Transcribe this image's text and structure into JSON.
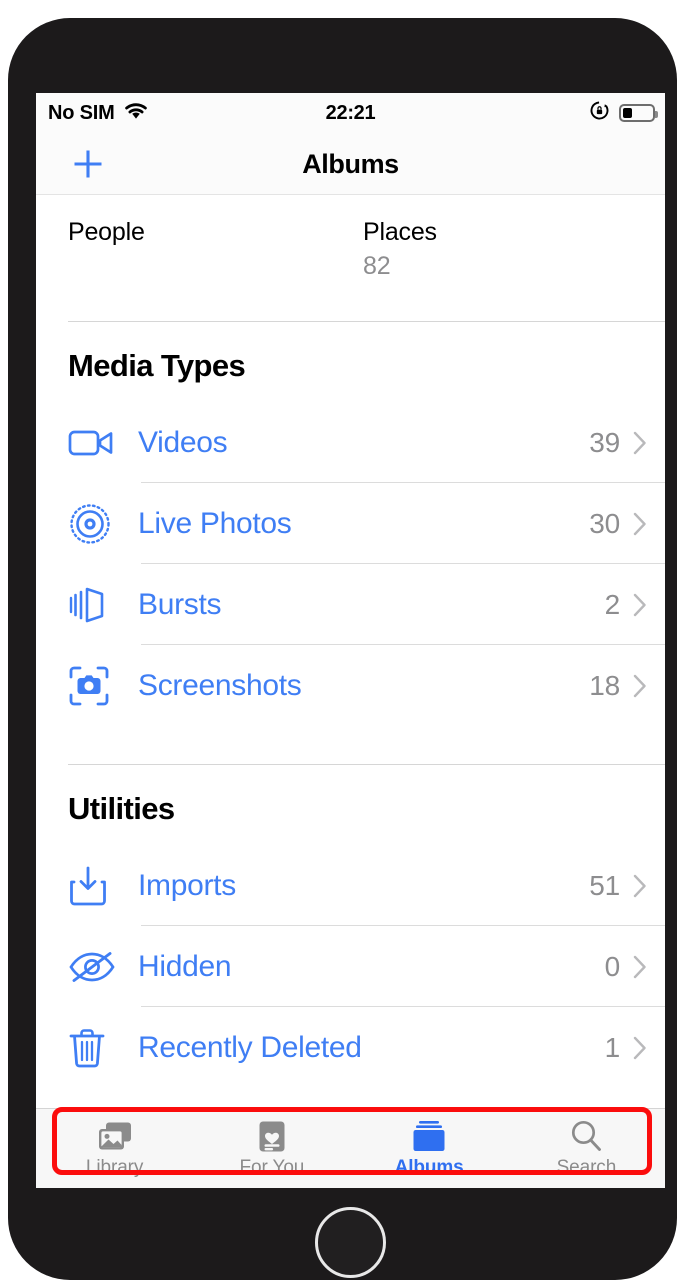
{
  "status_bar": {
    "carrier": "No SIM",
    "wifi_icon": "wifi-icon",
    "time": "22:21",
    "rotation_lock_icon": "rotation-lock-icon",
    "battery_icon": "battery-icon",
    "battery_level_percent": 32
  },
  "nav": {
    "add_icon": "plus-icon",
    "title": "Albums"
  },
  "people_places": {
    "people": {
      "label": "People",
      "count": ""
    },
    "places": {
      "label": "Places",
      "count": "82"
    }
  },
  "sections": [
    {
      "header": "Media Types",
      "rows": [
        {
          "icon": "video-camera-icon",
          "label": "Videos",
          "count": "39",
          "chevron": "chevron-right-icon"
        },
        {
          "icon": "live-photos-icon",
          "label": "Live Photos",
          "count": "30",
          "chevron": "chevron-right-icon"
        },
        {
          "icon": "bursts-icon",
          "label": "Bursts",
          "count": "2",
          "chevron": "chevron-right-icon"
        },
        {
          "icon": "screenshot-camera-icon",
          "label": "Screenshots",
          "count": "18",
          "chevron": "chevron-right-icon"
        }
      ]
    },
    {
      "header": "Utilities",
      "rows": [
        {
          "icon": "import-tray-icon",
          "label": "Imports",
          "count": "51",
          "chevron": "chevron-right-icon"
        },
        {
          "icon": "eye-slash-icon",
          "label": "Hidden",
          "count": "0",
          "chevron": "chevron-right-icon"
        },
        {
          "icon": "trash-icon",
          "label": "Recently Deleted",
          "count": "1",
          "chevron": "chevron-right-icon"
        }
      ]
    }
  ],
  "tabs": [
    {
      "icon": "photo-stack-icon",
      "label": "Library",
      "active": false
    },
    {
      "icon": "heart-card-icon",
      "label": "For You",
      "active": false
    },
    {
      "icon": "albums-folder-icon",
      "label": "Albums",
      "active": true
    },
    {
      "icon": "magnifier-icon",
      "label": "Search",
      "active": false
    }
  ],
  "annotation": {
    "highlight_target": "Recently Deleted",
    "highlight_color": "#fb0d0d"
  },
  "colors": {
    "accent_blue": "#3f7ef4",
    "tab_active_blue": "#2f6ff0",
    "secondary_gray": "#8d8d8f",
    "separator": "#dcdcdc",
    "screen_background": "#ffffff",
    "bar_background": "#f7f7f7",
    "device_body": "#1c1a1b"
  }
}
